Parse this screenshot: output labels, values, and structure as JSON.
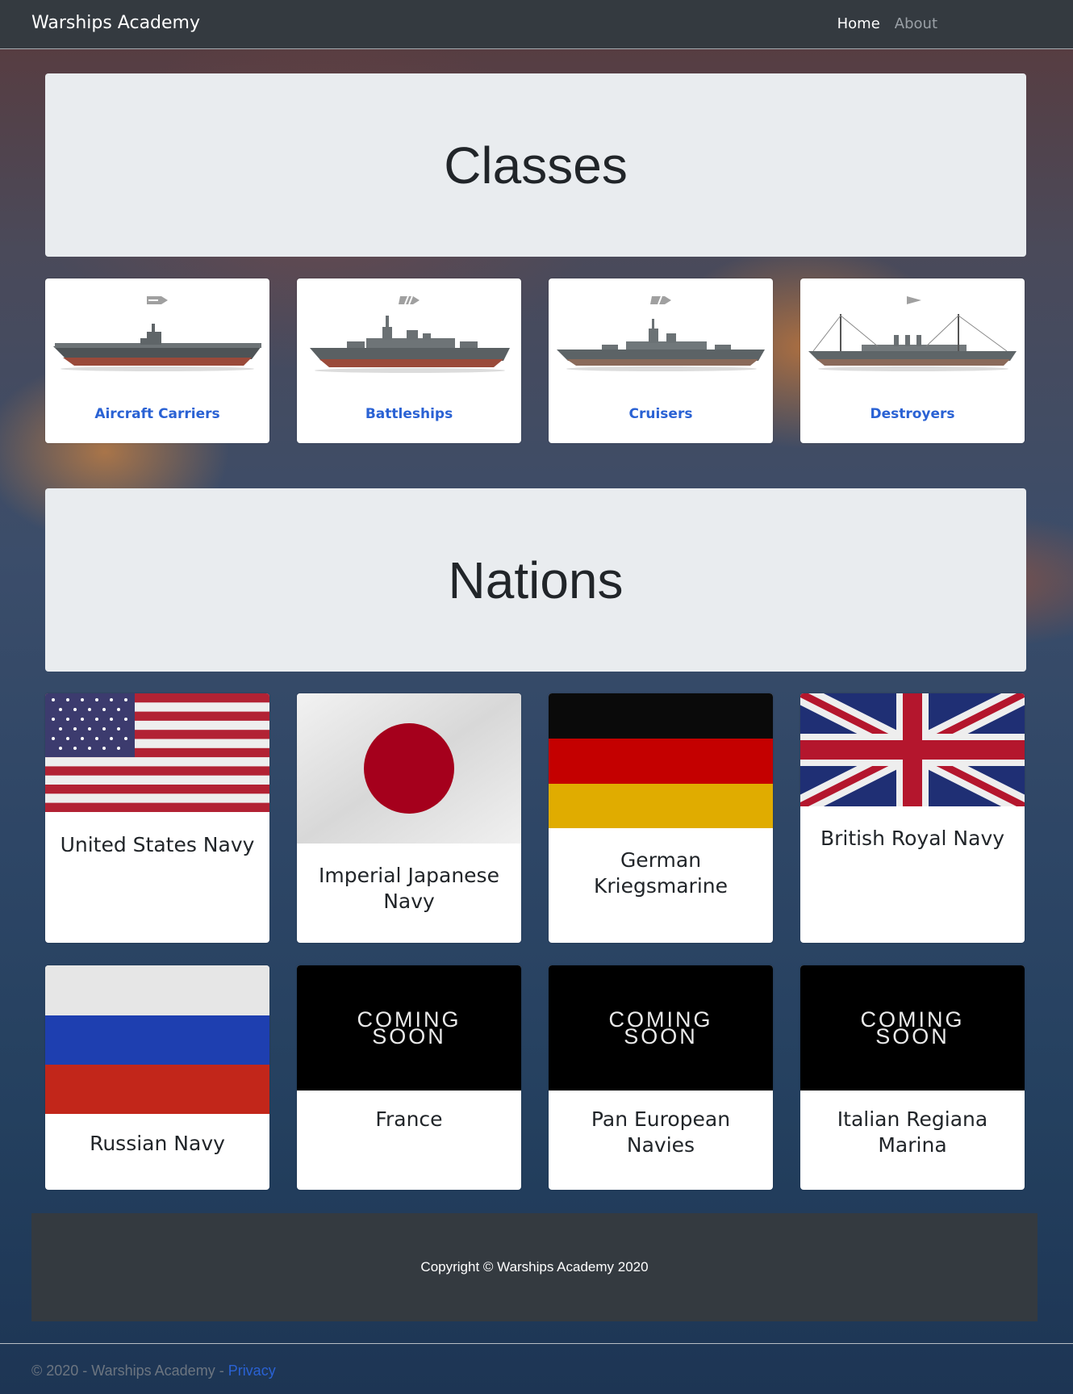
{
  "navbar": {
    "brand": "Warships Academy",
    "links": [
      {
        "label": "Home",
        "active": true
      },
      {
        "label": "About",
        "active": false
      }
    ]
  },
  "classes": {
    "title": "Classes",
    "items": [
      {
        "label": "Aircraft Carriers",
        "icon": "aircraft-carrier-class-icon"
      },
      {
        "label": "Battleships",
        "icon": "battleship-class-icon"
      },
      {
        "label": "Cruisers",
        "icon": "cruiser-class-icon"
      },
      {
        "label": "Destroyers",
        "icon": "destroyer-class-icon"
      }
    ]
  },
  "nations": {
    "title": "Nations",
    "items": [
      {
        "label": "United States Navy",
        "flag": "us-flag"
      },
      {
        "label": "Imperial Japanese Navy",
        "flag": "japan-flag"
      },
      {
        "label": "German Kriegsmarine",
        "flag": "germany-flag"
      },
      {
        "label": "British Royal Navy",
        "flag": "uk-flag"
      },
      {
        "label": "Russian Navy",
        "flag": "russia-flag"
      },
      {
        "label": "France",
        "flag": "coming-soon"
      },
      {
        "label": "Pan European Navies",
        "flag": "coming-soon"
      },
      {
        "label": "Italian Regiana Marina",
        "flag": "coming-soon"
      }
    ],
    "coming_soon": [
      "COMING",
      "SOON"
    ]
  },
  "footer": {
    "copyright": "Copyright © Warships Academy 2020",
    "bottom_text": "© 2020 - Warships Academy - ",
    "privacy_link": "Privacy"
  },
  "colors": {
    "navbar_bg": "#343a40",
    "jumbotron_bg": "#e9ecef",
    "link_blue": "#2a62d4"
  }
}
